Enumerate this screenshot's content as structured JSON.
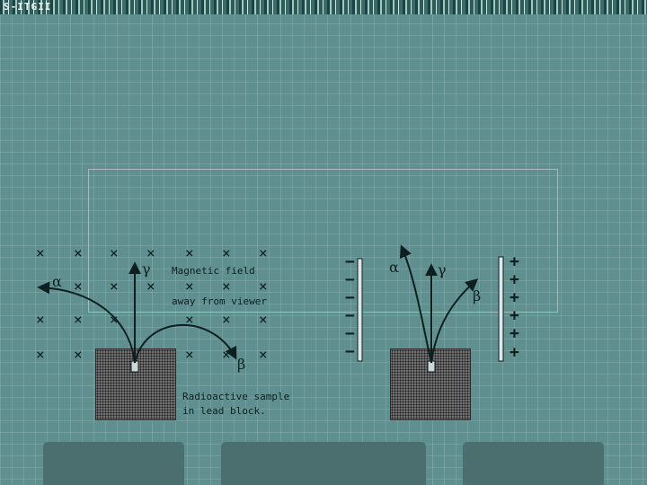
{
  "top_band": {
    "text": "S-ITGII"
  },
  "symbols": {
    "cross_mark": "×",
    "minus_sign": "−",
    "plus_sign": "+"
  },
  "magnetic": {
    "label_line1": "Magnetic field",
    "label_line2": "away from viewer",
    "alpha": "α",
    "beta": "β",
    "gamma": "γ"
  },
  "sample": {
    "line1": "Radioactive sample",
    "line2": "in lead block."
  },
  "electric": {
    "alpha": "α",
    "beta": "β",
    "gamma": "γ"
  },
  "colors": {
    "background": "#5f8f8f",
    "ink": "#0d1f1f",
    "lead": "#6f6f6f",
    "tab": "#4b6f6e"
  }
}
